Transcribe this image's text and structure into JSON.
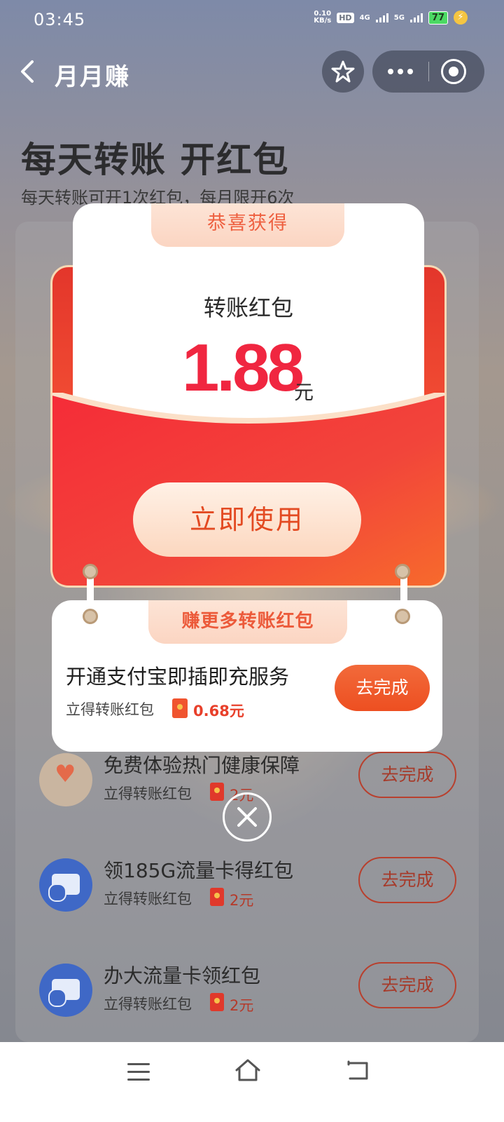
{
  "status_bar": {
    "time": "03:45",
    "speed_value": "0.10",
    "speed_unit": "KB/s",
    "hd_label": "HD",
    "sim1_label": "4G",
    "sim2_label": "5G",
    "battery": "77"
  },
  "titlebar": {
    "title": "月月赚"
  },
  "page": {
    "headline": "每天转账 开红包",
    "subline": "每天转账可开1次红包，每月限开6次"
  },
  "tasks": [
    {
      "title": "免费体验热门健康保障",
      "sub": "立得转账红包",
      "amount": "2元",
      "button": "去完成"
    },
    {
      "title": "领185G流量卡得红包",
      "sub": "立得转账红包",
      "amount": "2元",
      "button": "去完成"
    },
    {
      "title": "办大流量卡领红包",
      "sub": "立得转账红包",
      "amount": "2元",
      "button": "去完成"
    }
  ],
  "popup": {
    "congrats_label": "恭喜获得",
    "prize_name": "转账红包",
    "prize_amount": "1.88",
    "prize_unit": "元",
    "use_button": "立即使用",
    "more_label": "赚更多转账红包",
    "more_task": {
      "title": "开通支付宝即插即充服务",
      "sub": "立得转账红包",
      "amount": "0.68元",
      "button": "去完成"
    }
  },
  "colors": {
    "accent_red": "#f02640",
    "button_orange": "#ed4f21",
    "envelope_red": "#e3362b"
  }
}
